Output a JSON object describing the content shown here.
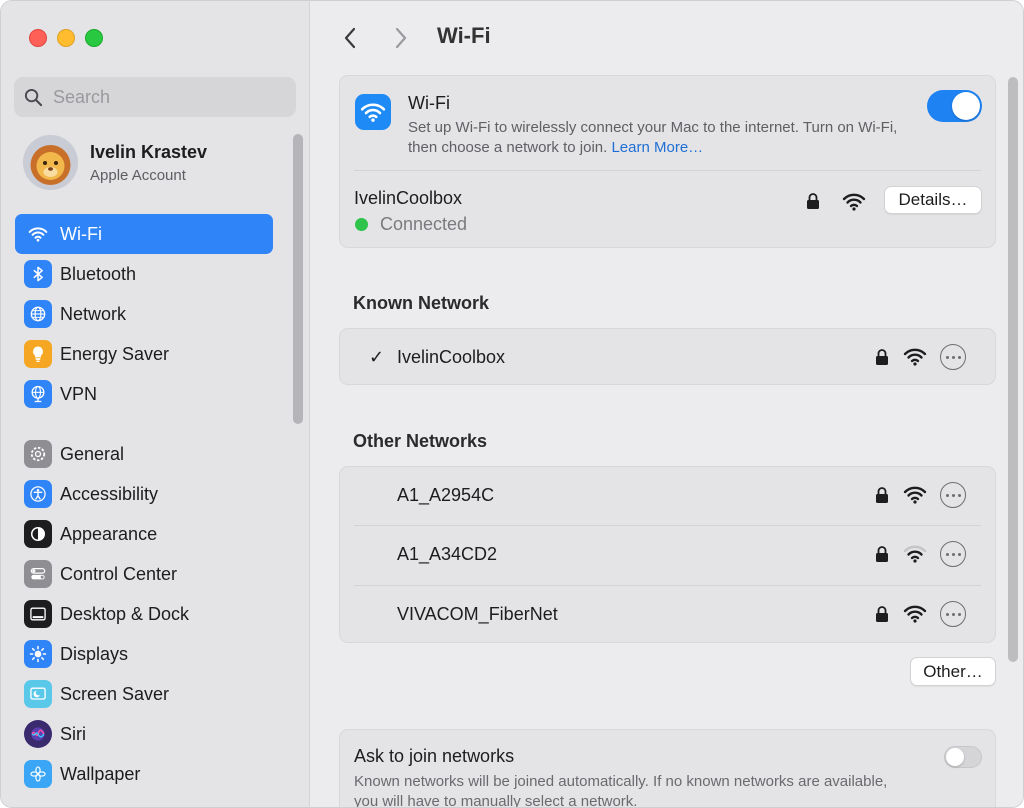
{
  "sidebar": {
    "search_placeholder": "Search",
    "account": {
      "name": "Ivelin Krastev",
      "subtitle": "Apple Account"
    },
    "group1": [
      {
        "label": "Wi-Fi",
        "icon": "wifi-icon",
        "color": "#2f84f7",
        "active": true
      },
      {
        "label": "Bluetooth",
        "icon": "bluetooth-icon",
        "color": "#2f84f7"
      },
      {
        "label": "Network",
        "icon": "globe-icon",
        "color": "#2f84f7"
      },
      {
        "label": "Energy Saver",
        "icon": "lightbulb-icon",
        "color": "#f5a623"
      },
      {
        "label": "VPN",
        "icon": "vpn-globe-icon",
        "color": "#2f84f7"
      }
    ],
    "group2": [
      {
        "label": "General",
        "icon": "gear-icon",
        "color": "#8e8e93"
      },
      {
        "label": "Accessibility",
        "icon": "accessibility-icon",
        "color": "#2f84f7"
      },
      {
        "label": "Appearance",
        "icon": "appearance-icon",
        "color": "#1d1d1f"
      },
      {
        "label": "Control Center",
        "icon": "control-center-icon",
        "color": "#8e8e93"
      },
      {
        "label": "Desktop & Dock",
        "icon": "dock-icon",
        "color": "#1d1d1f"
      },
      {
        "label": "Displays",
        "icon": "sun-icon",
        "color": "#2f84f7"
      },
      {
        "label": "Screen Saver",
        "icon": "screen-saver-icon",
        "color": "#5ac8e8"
      },
      {
        "label": "Siri",
        "icon": "siri-icon",
        "color": "#3a2a6e"
      },
      {
        "label": "Wallpaper",
        "icon": "flower-icon",
        "color": "#3aa6f5"
      }
    ]
  },
  "main": {
    "title": "Wi-Fi",
    "wifi": {
      "title": "Wi-Fi",
      "description": "Set up Wi-Fi to wirelessly connect your Mac to the internet. Turn on Wi-Fi, then choose a network to join.",
      "learn_more": "Learn More…",
      "enabled": true,
      "current_network": "IvelinCoolbox",
      "status": "Connected",
      "details_label": "Details…"
    },
    "known_heading": "Known Network",
    "known_networks": [
      {
        "name": "IvelinCoolbox",
        "checked": true,
        "signal": "full"
      }
    ],
    "other_heading": "Other Networks",
    "other_networks": [
      {
        "name": "A1_A2954C",
        "signal": "full"
      },
      {
        "name": "A1_A34CD2",
        "signal": "weak"
      },
      {
        "name": "VIVACOM_FiberNet",
        "signal": "full"
      }
    ],
    "other_button": "Other…",
    "ask_join": {
      "title": "Ask to join networks",
      "description": "Known networks will be joined automatically. If no known networks are available, you will have to manually select a network.",
      "enabled": false
    }
  }
}
